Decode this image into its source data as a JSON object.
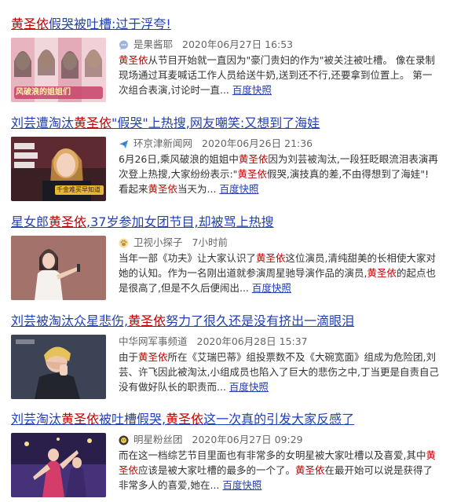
{
  "results": [
    {
      "title": [
        {
          "t": "黄圣依",
          "hl": true
        },
        {
          "t": "假哭被吐槽:过于浮夸!",
          "hl": false
        }
      ],
      "thumb_caption": "风破浪的姐姐们",
      "source_icon": "chat-bubble-icon",
      "source": "是果酱耶",
      "date": "2020年06月27日 16:53",
      "abstract": [
        {
          "t": "黄圣依",
          "hl": true
        },
        {
          "t": "从节目开始就一直因为\"豪门贵妇的作为\"被关注被吐槽。 像在录制现场通过耳麦喊话工作人员给送牛奶,送到还不行,还要拿到位置上。 第一次组合表演,讨论时一直...",
          "hl": false
        }
      ],
      "snapshot": "百度快照"
    },
    {
      "title": [
        {
          "t": "刘芸遭淘汰",
          "hl": false
        },
        {
          "t": "黄圣依",
          "hl": true
        },
        {
          "t": "\"假哭\"上热搜,网友嘲笑:又想到了海娃",
          "hl": false
        }
      ],
      "thumb_caption": "千金难买早知道",
      "source_icon": "paper-plane-icon",
      "source": "环京津新闻网",
      "date": "2020年06月26日 21:36",
      "abstract": [
        {
          "t": "6月26日,乘风破浪的姐姐中",
          "hl": false
        },
        {
          "t": "黄圣依",
          "hl": true
        },
        {
          "t": "因为刘芸被淘汰,一段狂眨眼流泪表演再次登上热搜,大家纷纷表示:\"",
          "hl": false
        },
        {
          "t": "黄圣依",
          "hl": true
        },
        {
          "t": "假哭,演技真的差,不由得想到了海娃\"! 看起来",
          "hl": false
        },
        {
          "t": "黄圣依",
          "hl": true
        },
        {
          "t": "当天为...",
          "hl": false
        }
      ],
      "snapshot": "百度快照"
    },
    {
      "title": [
        {
          "t": "星女郎",
          "hl": false
        },
        {
          "t": "黄圣依",
          "hl": true
        },
        {
          "t": ",37岁参加女团节目,却被骂上热搜",
          "hl": false
        }
      ],
      "thumb_caption": "",
      "source_icon": "paw-icon",
      "source": "卫视小探子",
      "date": "7小时前",
      "abstract": [
        {
          "t": "当年一部《功夫》让大家认识了",
          "hl": false
        },
        {
          "t": "黄圣依",
          "hl": true
        },
        {
          "t": "这位演员,清纯甜美的长相使大家对她的认知。作为一名刚出道就参演周星驰导演作品的演员,",
          "hl": false
        },
        {
          "t": "黄圣依",
          "hl": true
        },
        {
          "t": "的起点也是很高了,但是不久后便闹出...",
          "hl": false
        }
      ],
      "snapshot": "百度快照"
    },
    {
      "title": [
        {
          "t": "刘芸被淘汰众星悲伤,",
          "hl": false
        },
        {
          "t": "黄圣依",
          "hl": true
        },
        {
          "t": "努力了很久还是没有挤出一滴眼泪",
          "hl": false
        }
      ],
      "thumb_caption": "",
      "source_icon": "",
      "source": "中华网军事频道",
      "date": "2020年06月28日 15:37",
      "abstract": [
        {
          "t": "由于",
          "hl": false
        },
        {
          "t": "黄圣依",
          "hl": true
        },
        {
          "t": "所在《艾瑞巴蒂》组投票数不及《大碗宽面》组成为危险团,刘芸、许飞因此被淘汰,小组成员也陷入了巨大的悲伤之中,丁当更是自责自己没有做好队长的职责而...",
          "hl": false
        }
      ],
      "snapshot": "百度快照"
    },
    {
      "title": [
        {
          "t": "刘芸淘汰",
          "hl": false
        },
        {
          "t": "黄圣依",
          "hl": true
        },
        {
          "t": "被吐槽假哭,",
          "hl": false
        },
        {
          "t": "黄圣依",
          "hl": true
        },
        {
          "t": "这一次真的引发大家反感了",
          "hl": false
        }
      ],
      "thumb_caption": "",
      "source_icon": "star-face-icon",
      "source": "明星粉丝团",
      "date": "2020年06月27日 09:29",
      "abstract": [
        {
          "t": "而在这一档综艺节目里面也有非常多的女明星被大家吐槽以及喜爱,其中",
          "hl": false
        },
        {
          "t": "黄圣依",
          "hl": true
        },
        {
          "t": "应该是被大家吐槽的最多的一个了。",
          "hl": false
        },
        {
          "t": "黄圣依",
          "hl": true
        },
        {
          "t": "在最开始可以说是获得了非常多人的喜爱,她在...",
          "hl": false
        }
      ],
      "snapshot": "百度快照"
    }
  ]
}
